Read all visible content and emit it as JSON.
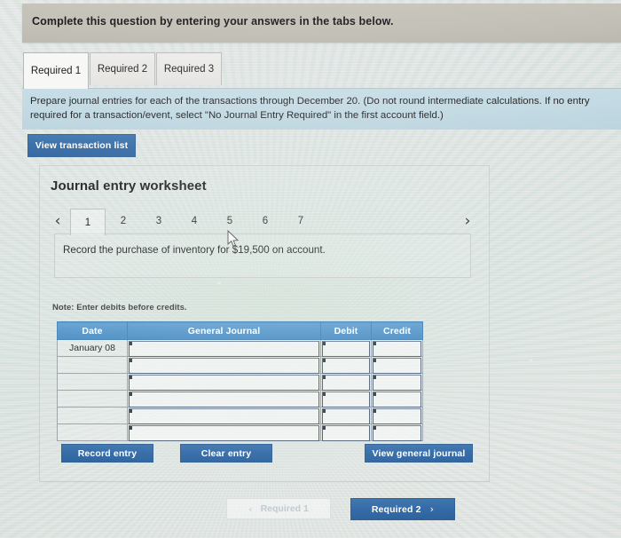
{
  "header": {
    "banner": "Complete this question by entering your answers in the tabs below."
  },
  "tabs": [
    {
      "label": "Required 1",
      "active": true
    },
    {
      "label": "Required 2",
      "active": false
    },
    {
      "label": "Required 3",
      "active": false
    }
  ],
  "instructions": {
    "text": "Prepare journal entries for each of the transactions through December 20. (Do not round intermediate calculations. If no entry\nrequired for a transaction/event, select \"No Journal Entry Required\" in the first account field.)"
  },
  "buttons": {
    "view_transaction_list": "View transaction list",
    "record_entry": "Record entry",
    "clear_entry": "Clear entry",
    "view_general_journal": "View general journal"
  },
  "worksheet": {
    "title": "Journal entry worksheet",
    "pager": {
      "prev_icon": "‹",
      "next_icon": "›",
      "pages": [
        "1",
        "2",
        "3",
        "4",
        "5",
        "6",
        "7"
      ],
      "active_page": "1"
    },
    "description": "Record the purchase of inventory for $19,500 on account.",
    "note": "Note: Enter debits before credits."
  },
  "journal_table": {
    "columns": [
      "Date",
      "General Journal",
      "Debit",
      "Credit"
    ],
    "rows": [
      {
        "date": "January 08",
        "general_journal": "",
        "debit": "",
        "credit": ""
      },
      {
        "date": "",
        "general_journal": "",
        "debit": "",
        "credit": ""
      },
      {
        "date": "",
        "general_journal": "",
        "debit": "",
        "credit": ""
      },
      {
        "date": "",
        "general_journal": "",
        "debit": "",
        "credit": ""
      },
      {
        "date": "",
        "general_journal": "",
        "debit": "",
        "credit": ""
      },
      {
        "date": "",
        "general_journal": "",
        "debit": "",
        "credit": ""
      }
    ]
  },
  "footer_nav": {
    "prev_label": "Required 1",
    "prev_icon": "‹",
    "next_label": "Required 2",
    "next_icon": "›"
  },
  "colors": {
    "accent_blue": "#2e67a4",
    "table_header_blue": "#4e92c8",
    "instruction_band": "#c0d8e2",
    "header_band": "#c1beb5"
  }
}
